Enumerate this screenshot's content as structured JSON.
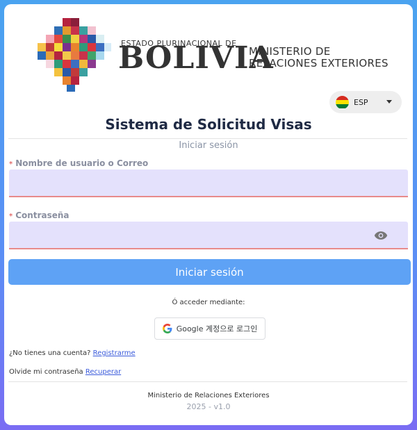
{
  "header": {
    "brand_top": "ESTADO PLURINACIONAL DE",
    "brand_name": "BOLIVIA",
    "ministry_line1": "MINISTERIO DE",
    "ministry_line2": "RELACIONES EXTERIORES"
  },
  "language": {
    "selected": "ESP",
    "flag_colors": [
      "#d52b1e",
      "#f9e300",
      "#007934"
    ]
  },
  "title": "Sistema de Solicitud Visas",
  "subtitle": "Iniciar sesión",
  "form": {
    "required_mark": "*",
    "username_label": "Nombre de usuario o Correo",
    "username_value": "",
    "password_label": "Contraseña",
    "password_value": "",
    "password_toggle_icon": "eye-icon",
    "submit_label": "Iniciar sesión"
  },
  "alt_login": {
    "label": "Ó acceder mediante:",
    "google_label": "Google 계정으로 로그인",
    "google_icon": "google-g-icon"
  },
  "register": {
    "text": "¿No tienes una cuenta?",
    "link": "Registrarme"
  },
  "recover": {
    "text": "Olvide mi contraseña",
    "link": "Recuperar"
  },
  "footer": {
    "org": "Ministerio de Relaciones Exteriores",
    "version": "2025 - v1.0"
  },
  "colors": {
    "accent": "#5ea2f5",
    "input_bg": "#e4e1fc",
    "error_underline": "#e88a8a",
    "title": "#1f2a44"
  }
}
